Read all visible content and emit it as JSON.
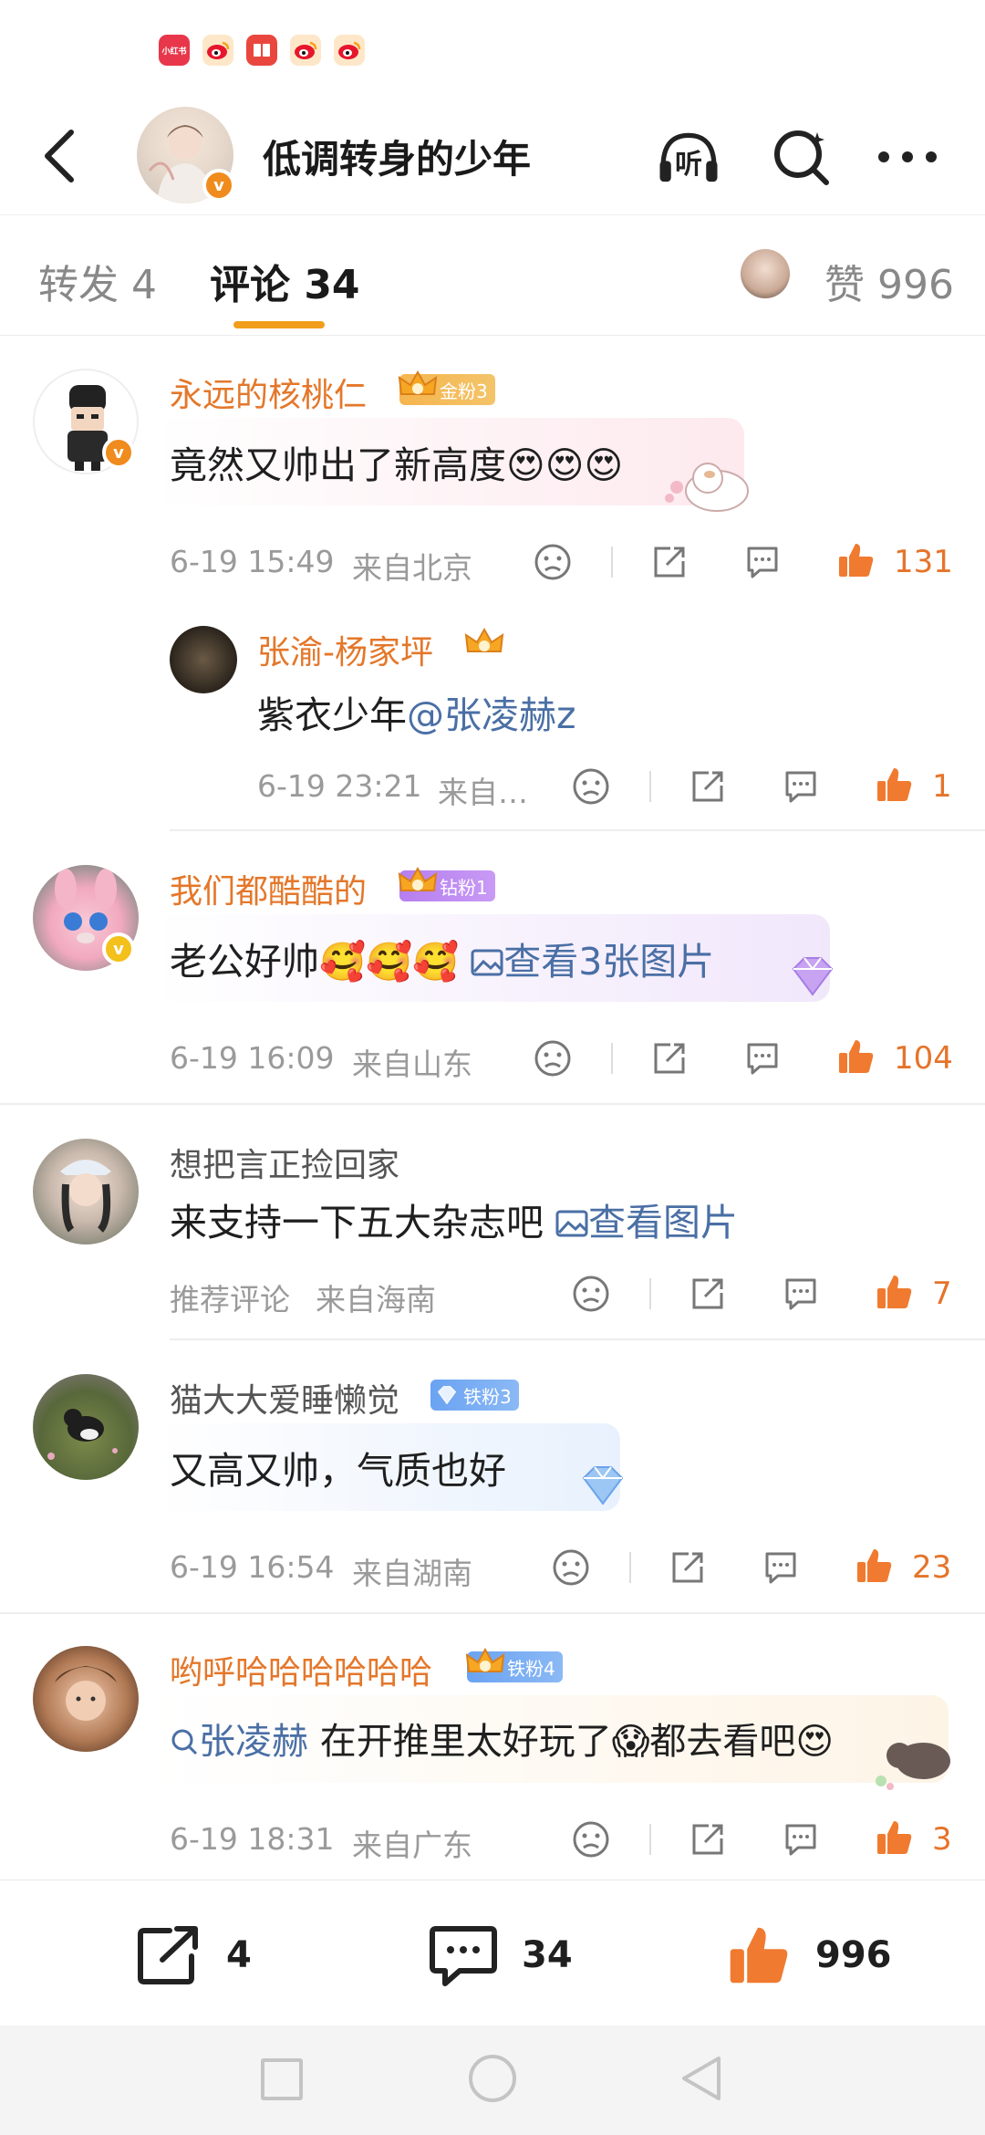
{
  "topbar": {
    "title": "低调转身的少年",
    "listen_label": "听"
  },
  "statusbar": {
    "app_icons": [
      "小红书",
      "weibo-icon",
      "reader-icon",
      "weibo-icon",
      "weibo-icon"
    ]
  },
  "tabs": {
    "repost": "转发 4",
    "comments": "评论 34",
    "likes": "赞 996"
  },
  "comments": [
    {
      "user": "永远的核桃仁",
      "badge": "金粉3",
      "text": "竟然又帅出了新高度",
      "emoji": "😍😍😍",
      "time": "6-19 15:49",
      "location": "来自北京",
      "likes": "131",
      "reply": {
        "user": "张渝-杨家坪",
        "text_prefix": "紫衣少年",
        "mention": "@张凌赫z",
        "time": "6-19 23:21",
        "location": "来自…",
        "likes": "1"
      }
    },
    {
      "user": "我们都酷酷的",
      "badge": "钻粉1",
      "text": "老公好帅",
      "emoji": "🥰🥰🥰",
      "image_link": "查看3张图片",
      "time": "6-19 16:09",
      "location": "来自山东",
      "likes": "104"
    },
    {
      "user": "想把言正捡回家",
      "text": "来支持一下五大杂志吧",
      "image_link": "查看图片",
      "time": "推荐评论",
      "location": "来自海南",
      "likes": "7"
    },
    {
      "user": "猫大大爱睡懒觉",
      "badge": "铁粉3",
      "text": "又高又帅，气质也好",
      "time": "6-19 16:54",
      "location": "来自湖南",
      "likes": "23"
    },
    {
      "user": "哟呼哈哈哈哈哈哈",
      "badge": "铁粉4",
      "search_link": "张凌赫",
      "text_mid": "在开推里太好玩了",
      "emoji_mid": "😱",
      "text_end": "都去看吧",
      "emoji_end": "😍",
      "time": "6-19 18:31",
      "location": "来自广东",
      "likes": "3"
    }
  ],
  "bottombar": {
    "repost_count": "4",
    "comment_count": "34",
    "like_count": "996"
  },
  "colors": {
    "accent_orange": "#e4772a",
    "tab_underline": "#f29d1b",
    "link_blue": "#4a6fa5"
  }
}
